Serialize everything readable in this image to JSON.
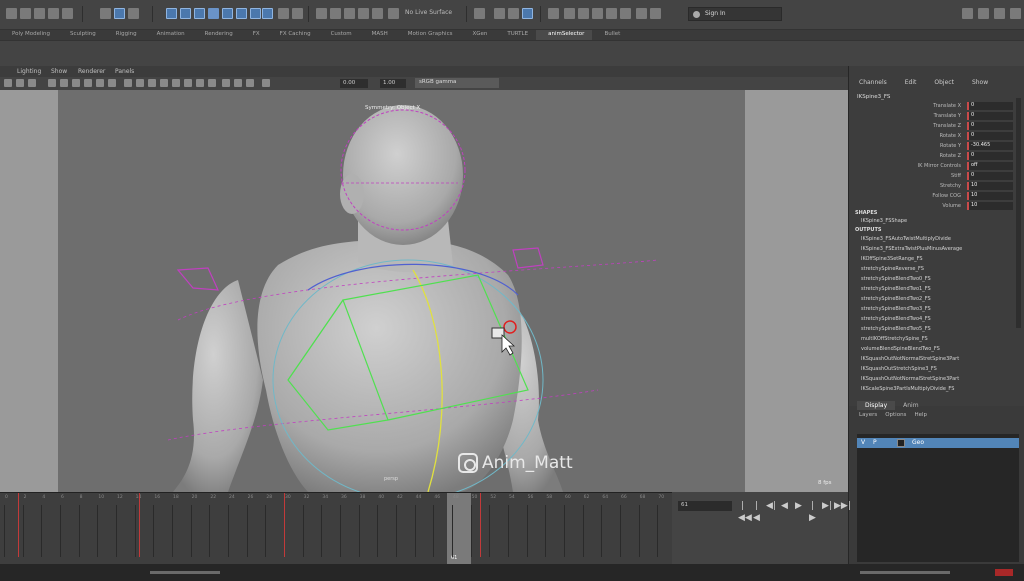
{
  "toolbar": {
    "live_surface": "No Live Surface",
    "sign_in": "Sign In"
  },
  "shelf": {
    "tabs": [
      "Poly Modeling",
      "Sculpting",
      "Rigging",
      "Animation",
      "Rendering",
      "FX",
      "FX Caching",
      "Custom",
      "MASH",
      "Motion Graphics",
      "XGen",
      "TURTLE",
      "animSelector",
      "Bullet"
    ],
    "active_tab": "animSelector"
  },
  "panel_menu": {
    "items": [
      "Lighting",
      "Show",
      "Renderer",
      "Panels"
    ],
    "field_a": "0.00",
    "field_b": "1.00",
    "color_space": "sRGB gamma"
  },
  "viewport": {
    "symmetry_label": "Symmetry: Object X",
    "fps": "8 fps",
    "watermark": "Anim_Matt",
    "camera": "persp"
  },
  "channel_box": {
    "menu": [
      "Channels",
      "Edit",
      "Object",
      "Show"
    ],
    "node": "IKSpine3_FS",
    "attributes": [
      {
        "name": "Translate X",
        "value": "0"
      },
      {
        "name": "Translate Y",
        "value": "0"
      },
      {
        "name": "Translate Z",
        "value": "0"
      },
      {
        "name": "Rotate X",
        "value": "0"
      },
      {
        "name": "Rotate Y",
        "value": "-30.465"
      },
      {
        "name": "Rotate Z",
        "value": "0"
      },
      {
        "name": "IK Mirror Controls",
        "value": "off"
      },
      {
        "name": "Stiff",
        "value": "0"
      },
      {
        "name": "Stretchy",
        "value": "10"
      },
      {
        "name": "Follow COG",
        "value": "10"
      },
      {
        "name": "Volume",
        "value": "10"
      }
    ],
    "shapes_header": "SHAPES",
    "shapes": [
      "IKSpine3_FSShape"
    ],
    "outputs_header": "OUTPUTS",
    "outputs": [
      "IKSpine3_FSAutoTwistMultiplyDivide",
      "IKSpine3_FSExtraTwistPlusMinusAverage",
      "IKOffSpine3SetRange_FS",
      "stretchySpineReverse_FS",
      "stretchySpineBlendTwo0_FS",
      "stretchySpineBlendTwo1_FS",
      "stretchySpineBlendTwo2_FS",
      "stretchySpineBlendTwo3_FS",
      "stretchySpineBlendTwo4_FS",
      "stretchySpineBlendTwo5_FS",
      "multIKOffStretchySpine_FS",
      "volumeBlendSpineBlendTwo_FS",
      "IKSquashOutNotNormalStretSpine3Part",
      "IKSquashOutStretchSpine3_FS",
      "IKSquashOutNotNormalStretSpine3Part",
      "IKScaleSpine3PartIsMultiplyDivide_FS"
    ]
  },
  "layer_editor": {
    "tabs": [
      "Display",
      "Anim"
    ],
    "active_tab": "Display",
    "menu": [
      "Layers",
      "Options",
      "Help"
    ],
    "layer": {
      "visible": "V",
      "playback": "P",
      "name": "Geo"
    }
  },
  "timeline": {
    "ticks": [
      "0",
      "2",
      "4",
      "6",
      "8",
      "10",
      "12",
      "14",
      "16",
      "18",
      "20",
      "22",
      "24",
      "26",
      "28",
      "30",
      "32",
      "34",
      "36",
      "38",
      "40",
      "42",
      "44",
      "46",
      "48",
      "50",
      "52",
      "54",
      "56",
      "58",
      "60",
      "62",
      "64",
      "66",
      "68",
      "70"
    ],
    "keys": [
      1.5,
      14.5,
      30,
      51
    ],
    "range_end": 70,
    "current_frame": "61",
    "frame_field": "61"
  },
  "playback": {
    "buttons": [
      "|◀◀",
      "|◀",
      "◀|",
      "◀",
      "▶",
      "|▶",
      "▶|",
      "▶▶|"
    ]
  }
}
